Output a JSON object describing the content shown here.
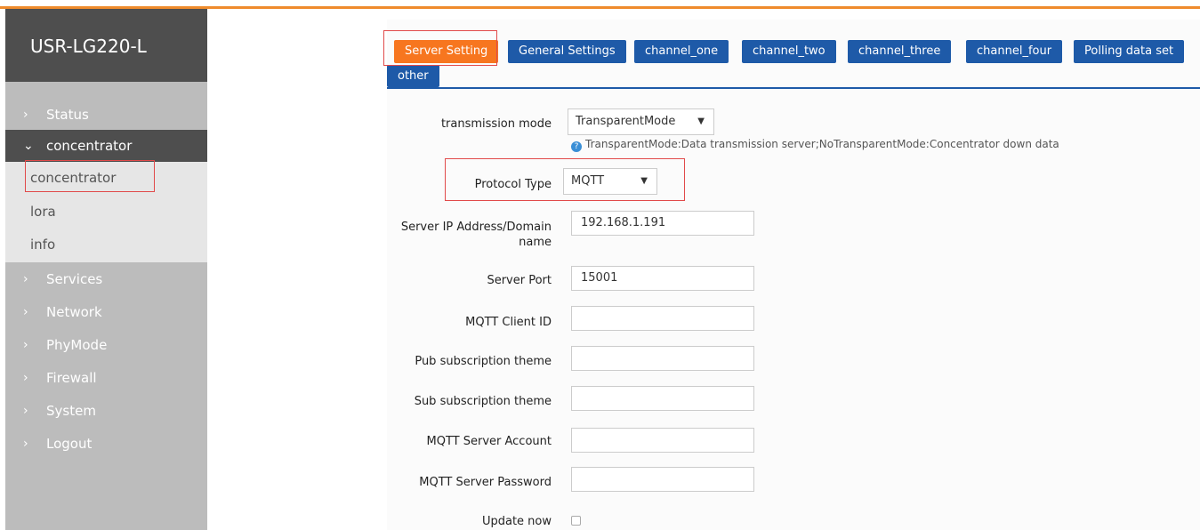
{
  "brand": "USR-LG220-L",
  "sidebar": {
    "items": [
      {
        "label": "Status"
      },
      {
        "label": "concentrator"
      },
      {
        "label": "Services"
      },
      {
        "label": "Network"
      },
      {
        "label": "PhyMode"
      },
      {
        "label": "Firewall"
      },
      {
        "label": "System"
      },
      {
        "label": "Logout"
      }
    ],
    "subitems": [
      {
        "label": "concentrator"
      },
      {
        "label": "lora"
      },
      {
        "label": "info"
      }
    ]
  },
  "tabs": [
    "Server Setting",
    "General Settings",
    "channel_one",
    "channel_two",
    "channel_three",
    "channel_four",
    "Polling data set",
    "other"
  ],
  "form": {
    "transmission_mode": {
      "label": "transmission mode",
      "value": "TransparentMode"
    },
    "hint": "TransparentMode:Data transmission server;NoTransparentMode:Concentrator down data",
    "protocol_type": {
      "label": "Protocol Type",
      "value": "MQTT"
    },
    "server_ip": {
      "label_line1": "Server IP Address/Domain",
      "label_line2": "name",
      "value": "192.168.1.191"
    },
    "server_port": {
      "label": "Server Port",
      "value": "15001"
    },
    "mqtt_client_id": {
      "label": "MQTT Client ID",
      "value": ""
    },
    "pub_theme": {
      "label": "Pub subscription theme",
      "value": ""
    },
    "sub_theme": {
      "label": "Sub subscription theme",
      "value": ""
    },
    "mqtt_account": {
      "label": "MQTT Server Account",
      "value": ""
    },
    "mqtt_password": {
      "label": "MQTT Server Password",
      "value": ""
    },
    "update_now": {
      "label": "Update now",
      "checked": false
    }
  },
  "colors": {
    "accent_orange": "#f7761f",
    "tab_blue": "#1e5aa8",
    "sidebar_dark": "#4e4e4e",
    "sidebar_gray": "#bcbcbc",
    "highlight_red": "#e14a4a"
  },
  "icons": {
    "collapsed": "chevron-right-icon",
    "expanded": "chevron-down-icon",
    "hint": "question-icon",
    "select": "caret-down-icon"
  }
}
